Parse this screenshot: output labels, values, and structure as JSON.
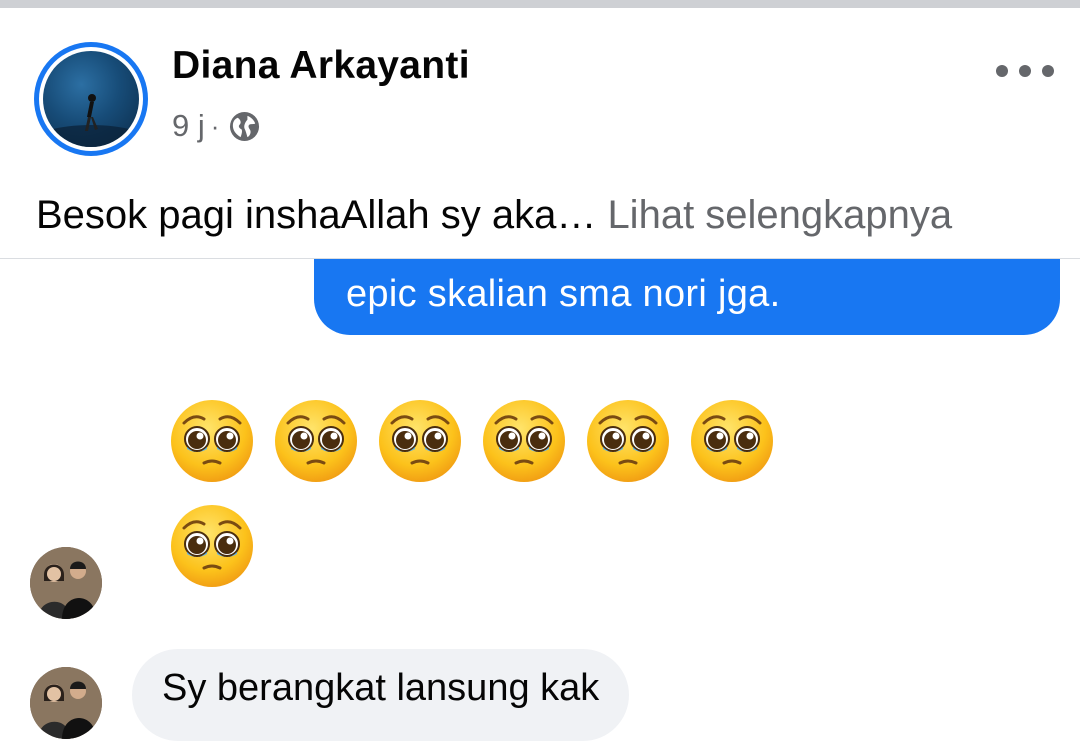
{
  "post": {
    "author": "Diana Arkayanti",
    "time": "9 j",
    "separator": "·",
    "privacy_icon": "globe-icon",
    "text": "Besok pagi inshaAllah sy aka…",
    "see_more": "Lihat selengkapnya",
    "more_icon": "more-options-icon"
  },
  "chat": {
    "outgoing_message": "epic skalian sma nori jga.",
    "emoji_name": "pleading-face-emoji",
    "emoji_count": 7,
    "incoming_message": "Sy berangkat lansung kak"
  },
  "colors": {
    "accent": "#1877f2",
    "secondary_text": "#65676b",
    "incoming_bubble": "#f0f2f5"
  }
}
